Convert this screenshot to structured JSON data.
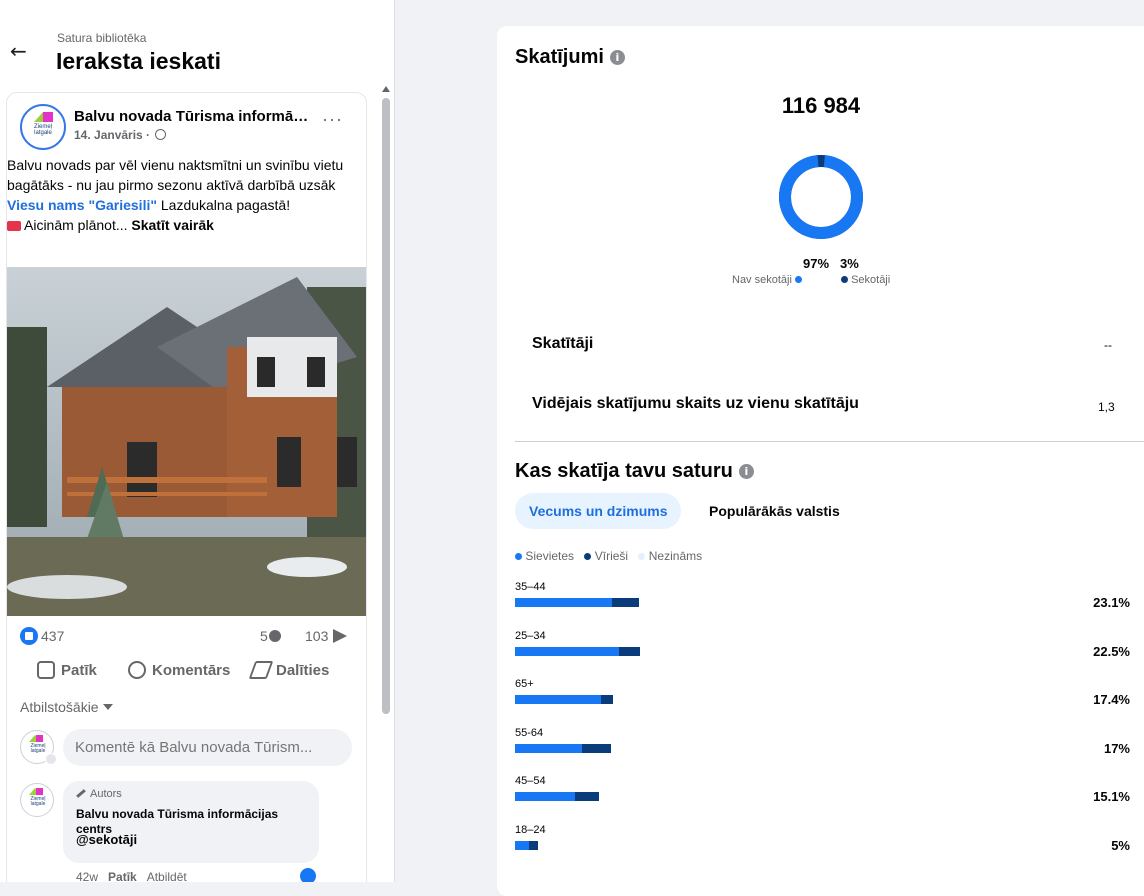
{
  "header": {
    "breadcrumb": "Satura bibliotēka",
    "title": "Ieraksta ieskati"
  },
  "post": {
    "page_name": "Balvu novada Tūrisma informāci...",
    "logo_text": "Ziemeļ latgale",
    "date": "14. Janvāris · ",
    "text_part1": "Balvu novads par vēl vienu naktsmītni un svinību vietu bagātāks - nu jau pirmo sezonu aktīvā darbībā uzsāk ",
    "text_link": "Viesu nams \"Gariesili\"",
    "text_part2": " Lazdukalna pagastā!",
    "text_part3": "Aicinām plānot... ",
    "see_more": "Skatīt vairāk",
    "more_icon": "···",
    "reactions": "437",
    "comments": "5",
    "shares": "103",
    "actions": {
      "like": "Patīk",
      "comment": "Komentārs",
      "share": "Dalīties"
    },
    "relevance": "Atbilstošākie",
    "comment_placeholder": "Komentē kā Balvu novada Tūrism...",
    "comment": {
      "author_tag": "Autors",
      "author": "Balvu novada Tūrisma informācijas centrs",
      "text": "@sekotāji",
      "time": "42w",
      "like": "Patīk",
      "reply": "Atbildēt"
    }
  },
  "views": {
    "title": "Skatījumi",
    "info_icon": "i",
    "total": "116 984",
    "non_followers_pct": "97%",
    "followers_pct": "3%",
    "non_followers_label": "Nav sekotāji",
    "followers_label": "Sekotāji",
    "non_followers_fraction": 0.97,
    "viewers_label": "Skatītāji",
    "viewers_value": "--",
    "avg_label": "Vidējais skatījumu skaits uz vienu skatītāju",
    "avg_value": "1,3"
  },
  "audience": {
    "title": "Kas skatīja tavu saturu",
    "tabs": [
      "Vecums un dzimums",
      "Populārākās valstis"
    ],
    "legend": [
      "Sievietes",
      "Vīrieši",
      "Nezināms"
    ],
    "rows": [
      {
        "label": "35–44",
        "pct": "23.1%",
        "women": 15.9,
        "men": 4.5
      },
      {
        "label": "25–34",
        "pct": "22.5%",
        "women": 17.0,
        "men": 3.5
      },
      {
        "label": "65+",
        "pct": "17.4%",
        "women": 14.1,
        "men": 1.9
      },
      {
        "label": "55-64",
        "pct": "17%",
        "women": 11.0,
        "men": 4.7
      },
      {
        "label": "45–54",
        "pct": "15.1%",
        "women": 9.9,
        "men": 3.8
      },
      {
        "label": "18–24",
        "pct": "5%",
        "women": 2.3,
        "men": 1.5
      }
    ]
  },
  "colors": {
    "women": "#1877f2",
    "men": "#0a3b7a",
    "unknown": "#e4f0fd",
    "link": "#216fdb"
  }
}
